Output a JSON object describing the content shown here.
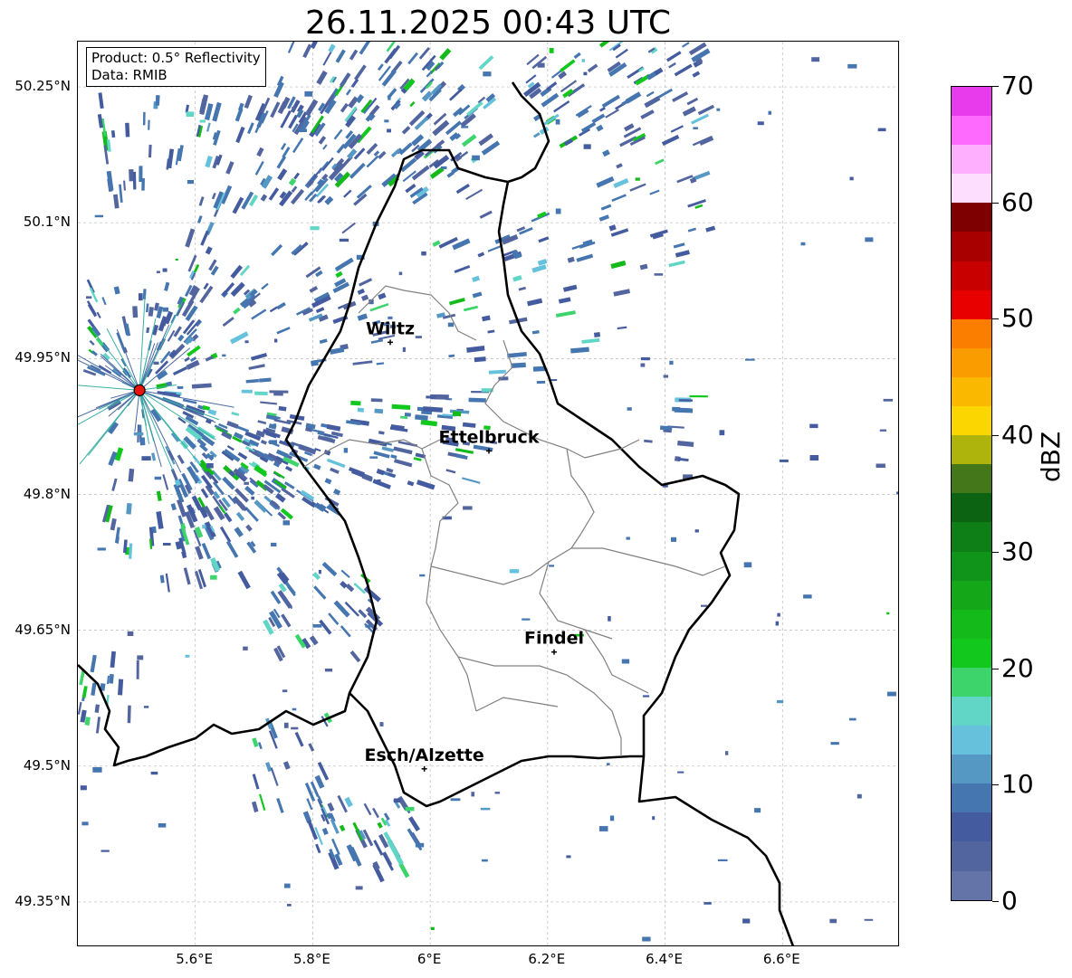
{
  "title": "26.11.2025 00:43 UTC",
  "info_box": {
    "product_line": "Product: 0.5° Reflectivity",
    "data_line": "Data: RMIB"
  },
  "map": {
    "lat_range": [
      49.3,
      50.3
    ],
    "lon_range": [
      5.4,
      6.8
    ],
    "lat_ticks": [
      "50.25°N",
      "50.1°N",
      "49.95°N",
      "49.8°N",
      "49.65°N",
      "49.5°N",
      "49.35°N"
    ],
    "lat_tick_values": [
      50.25,
      50.1,
      49.95,
      49.8,
      49.65,
      49.5,
      49.35
    ],
    "lon_ticks": [
      "5.6°E",
      "5.8°E",
      "6°E",
      "6.2°E",
      "6.4°E",
      "6.6°E"
    ],
    "lon_tick_values": [
      5.6,
      5.8,
      6.0,
      6.2,
      6.4,
      6.6
    ],
    "radar_site": {
      "lat": 49.915,
      "lon": 5.505,
      "color": "#e8140c"
    },
    "cities": [
      {
        "name": "Wiltz",
        "lat": 49.968,
        "lon": 5.932
      },
      {
        "name": "Ettelbruck",
        "lat": 49.848,
        "lon": 6.1
      },
      {
        "name": "Findel",
        "lat": 49.626,
        "lon": 6.211
      },
      {
        "name": "Esch/Alzette",
        "lat": 49.497,
        "lon": 5.99
      }
    ]
  },
  "colorbar": {
    "unit": "dBZ",
    "min": 0,
    "max": 70,
    "tick_labels": [
      "70",
      "60",
      "50",
      "40",
      "30",
      "20",
      "10",
      "0"
    ],
    "tick_values": [
      70,
      60,
      50,
      40,
      30,
      20,
      10,
      0
    ],
    "colors_low_to_high": [
      "#6474a8",
      "#52659f",
      "#445c9f",
      "#4676b0",
      "#5698c4",
      "#66c1dc",
      "#62d6c6",
      "#3dd46c",
      "#12c81c",
      "#14ba1a",
      "#14a818",
      "#10941a",
      "#0e7e16",
      "#0c6412",
      "#44761a",
      "#aeb40c",
      "#fcd600",
      "#fab800",
      "#fa9c00",
      "#fc7e00",
      "#e80000",
      "#c80000",
      "#a80000",
      "#7e0000",
      "#fedefe",
      "#feb0fe",
      "#fe6afe",
      "#e83cec"
    ]
  }
}
